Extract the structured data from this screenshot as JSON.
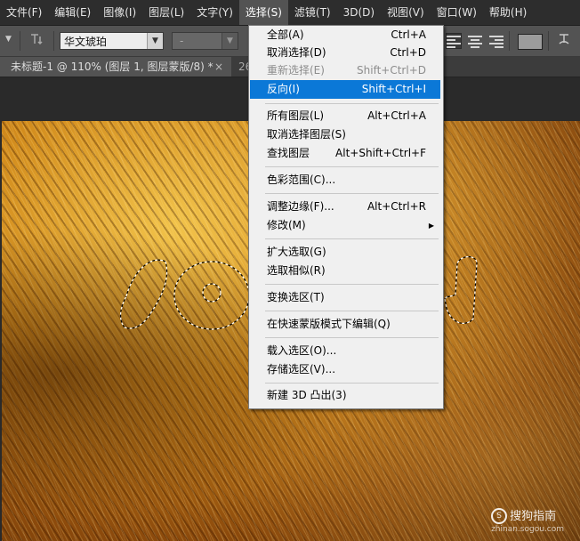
{
  "menubar": {
    "items": [
      "文件(F)",
      "编辑(E)",
      "图像(I)",
      "图层(L)",
      "文字(Y)",
      "选择(S)",
      "滤镜(T)",
      "3D(D)",
      "视图(V)",
      "窗口(W)",
      "帮助(H)"
    ],
    "active_index": 5
  },
  "options_bar": {
    "font_family": "华文琥珀",
    "font_style": "-",
    "color_swatch": "#9c9c9c"
  },
  "document_tabs": [
    {
      "title": "未标题-1 @ 110% (图层 1, 图层蒙版/8) *",
      "close": "×"
    },
    {
      "title": "26"
    }
  ],
  "select_menu": {
    "items": [
      {
        "label": "全部(A)",
        "shortcut": "Ctrl+A",
        "disabled": false
      },
      {
        "label": "取消选择(D)",
        "shortcut": "Ctrl+D",
        "disabled": false
      },
      {
        "label": "重新选择(E)",
        "shortcut": "Shift+Ctrl+D",
        "disabled": true
      },
      {
        "label": "反向(I)",
        "shortcut": "Shift+Ctrl+I",
        "disabled": false,
        "highlighted": true
      },
      {
        "label": "所有图层(L)",
        "shortcut": "Alt+Ctrl+A",
        "disabled": false
      },
      {
        "label": "取消选择图层(S)",
        "shortcut": "",
        "disabled": false
      },
      {
        "label": "查找图层",
        "shortcut": "Alt+Shift+Ctrl+F",
        "disabled": false
      },
      {
        "label": "色彩范围(C)...",
        "shortcut": "",
        "disabled": false
      },
      {
        "label": "调整边缘(F)...",
        "shortcut": "Alt+Ctrl+R",
        "disabled": false
      },
      {
        "label": "修改(M)",
        "shortcut": "",
        "disabled": false,
        "submenu": true
      },
      {
        "label": "扩大选取(G)",
        "shortcut": "",
        "disabled": false
      },
      {
        "label": "选取相似(R)",
        "shortcut": "",
        "disabled": false
      },
      {
        "label": "变换选区(T)",
        "shortcut": "",
        "disabled": false
      },
      {
        "label": "在快速蒙版模式下编辑(Q)",
        "shortcut": "",
        "disabled": false
      },
      {
        "label": "载入选区(O)...",
        "shortcut": "",
        "disabled": false
      },
      {
        "label": "存储选区(V)...",
        "shortcut": "",
        "disabled": false
      },
      {
        "label": "新建 3D 凸出(3)",
        "shortcut": "",
        "disabled": false
      }
    ]
  },
  "watermark": {
    "brand": "搜狗指南",
    "site": "zhinan.sogou.com",
    "logo_char": "S"
  }
}
